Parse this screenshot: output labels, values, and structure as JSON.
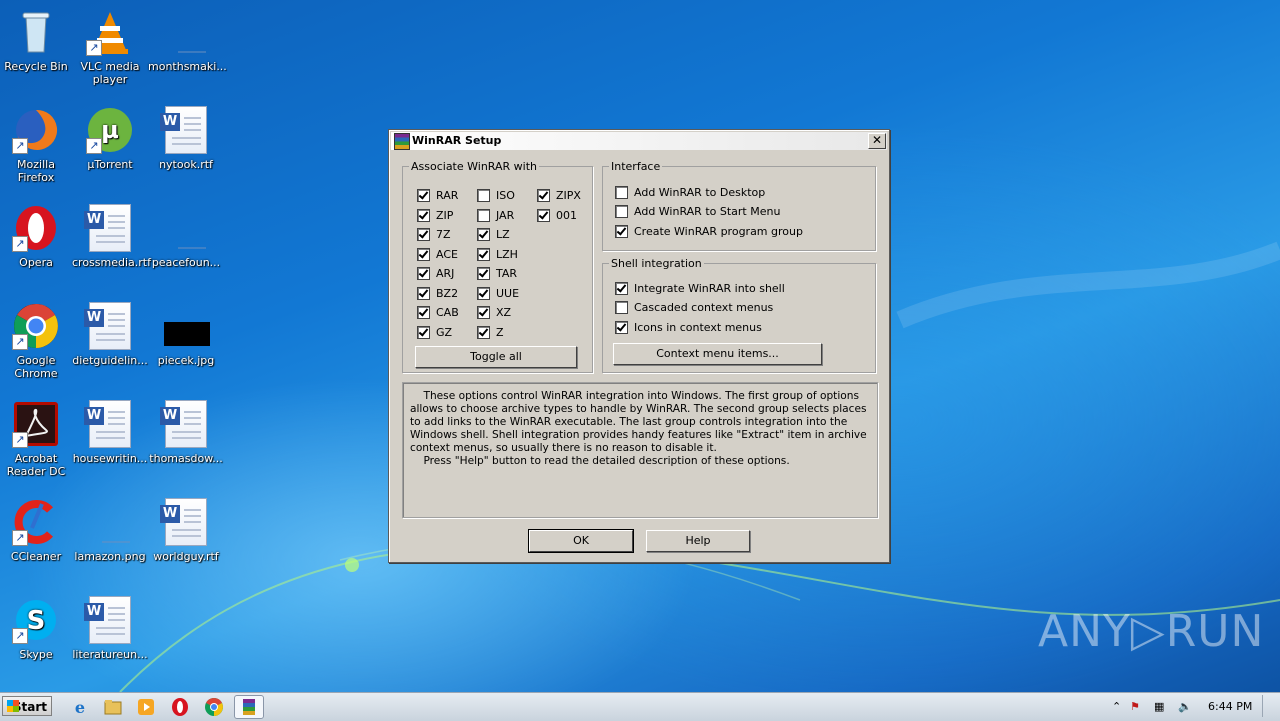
{
  "desktop": {
    "icons": [
      {
        "label": "Recycle Bin",
        "icon": "recycle-bin-icon"
      },
      {
        "label": "VLC media player",
        "icon": "vlc-icon"
      },
      {
        "label": "monthsmaki...",
        "icon": "file-icon"
      },
      {
        "label": "Mozilla Firefox",
        "icon": "firefox-icon"
      },
      {
        "label": "µTorrent",
        "icon": "utorrent-icon"
      },
      {
        "label": "nytook.rtf",
        "icon": "word-document-icon"
      },
      {
        "label": "Opera",
        "icon": "opera-icon"
      },
      {
        "label": "crossmedia.rtf",
        "icon": "word-document-icon"
      },
      {
        "label": "peacefoun...",
        "icon": "file-icon"
      },
      {
        "label": "Google Chrome",
        "icon": "chrome-icon"
      },
      {
        "label": "dietguidelin...",
        "icon": "word-document-icon"
      },
      {
        "label": "piecek.jpg",
        "icon": "image-icon"
      },
      {
        "label": "Acrobat Reader DC",
        "icon": "acrobat-icon"
      },
      {
        "label": "housewritin...",
        "icon": "word-document-icon"
      },
      {
        "label": "thomasdow...",
        "icon": "word-document-icon"
      },
      {
        "label": "CCleaner",
        "icon": "ccleaner-icon"
      },
      {
        "label": "lamazon.png",
        "icon": "image-icon"
      },
      {
        "label": "worldguy.rtf",
        "icon": "word-document-icon"
      },
      {
        "label": "Skype",
        "icon": "skype-icon"
      },
      {
        "label": "literatureun...",
        "icon": "word-document-icon"
      }
    ]
  },
  "dialog": {
    "title": "WinRAR Setup",
    "close_glyph": "✕",
    "associate": {
      "legend": "Associate WinRAR with",
      "items": [
        {
          "label": "RAR",
          "checked": true
        },
        {
          "label": "ZIP",
          "checked": true
        },
        {
          "label": "7Z",
          "checked": true
        },
        {
          "label": "ACE",
          "checked": true
        },
        {
          "label": "ARJ",
          "checked": true
        },
        {
          "label": "BZ2",
          "checked": true
        },
        {
          "label": "CAB",
          "checked": true
        },
        {
          "label": "GZ",
          "checked": true
        },
        {
          "label": "ISO",
          "checked": false
        },
        {
          "label": "JAR",
          "checked": false
        },
        {
          "label": "LZ",
          "checked": true
        },
        {
          "label": "LZH",
          "checked": true
        },
        {
          "label": "TAR",
          "checked": true
        },
        {
          "label": "UUE",
          "checked": true
        },
        {
          "label": "XZ",
          "checked": true
        },
        {
          "label": "Z",
          "checked": true
        },
        {
          "label": "ZIPX",
          "checked": true
        },
        {
          "label": "001",
          "checked": true
        }
      ],
      "toggle_label": "Toggle all"
    },
    "interface": {
      "legend": "Interface",
      "items": [
        {
          "label": "Add WinRAR to Desktop",
          "checked": false
        },
        {
          "label": "Add WinRAR to Start Menu",
          "checked": false
        },
        {
          "label": "Create WinRAR program group",
          "checked": true
        }
      ]
    },
    "shell": {
      "legend": "Shell integration",
      "items": [
        {
          "label": "Integrate WinRAR into shell",
          "checked": true
        },
        {
          "label": "Cascaded context menus",
          "checked": false
        },
        {
          "label": "Icons in context menus",
          "checked": true
        }
      ],
      "context_button": "Context menu items..."
    },
    "info": "    These options control WinRAR integration into Windows. The first group of options allows to choose archive types to handle by WinRAR. The second group selects places to add links to the WinRAR executable. The last group controls integration into the Windows shell. Shell integration provides handy features like \"Extract\" item in archive context menus, so usually there is no reason to disable it.\n    Press \"Help\" button to read the detailed description of these options.",
    "ok_label": "OK",
    "help_label": "Help"
  },
  "taskbar": {
    "start_label": "Start",
    "pinned": [
      "internet-explorer-icon",
      "explorer-icon",
      "media-player-icon",
      "opera-icon",
      "chrome-icon",
      "winrar-icon"
    ],
    "clock": "6:44 PM"
  },
  "watermark": "ANY▷RUN"
}
